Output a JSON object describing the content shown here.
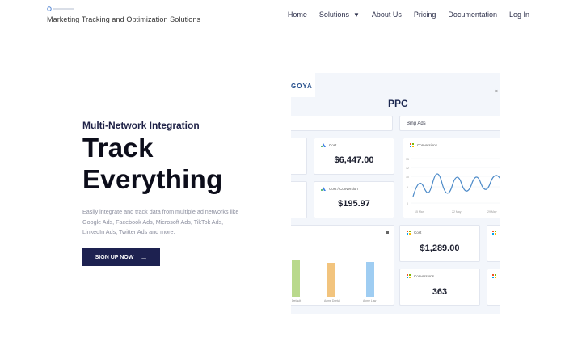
{
  "header": {
    "tagline": "Marketing Tracking and Optimization Solutions",
    "nav": [
      {
        "label": "Home"
      },
      {
        "label": "Solutions",
        "caret": "▼"
      },
      {
        "label": "About Us"
      },
      {
        "label": "Pricing"
      },
      {
        "label": "Documentation"
      },
      {
        "label": "Log In"
      }
    ]
  },
  "hero": {
    "eyebrow": "Multi-Network Integration",
    "title_line1": "Track",
    "title_line2": "Everything",
    "description": "Easily integrate and track data from multiple ad networks like Google Ads, Facebook Ads, Microsoft Ads, TikTok Ads, LinkedIn Ads, Twitter Ads and more.",
    "cta_label": "SIGN UP NOW",
    "cta_arrow": "→"
  },
  "dashboard": {
    "brand": "GOYA",
    "close": "×",
    "title": "PPC",
    "filter_selected": "Bing Ads",
    "cost_label": "Cost",
    "cost_value": "$6,447.00",
    "cpc_label": "Cost / Conversion",
    "cpc_value": "$195.97",
    "conv_chart_label": "Conversions",
    "conv_chart_yticks": [
      "15",
      "12",
      "10",
      "5",
      "0"
    ],
    "conv_chart_xticks": [
      "15 Mar",
      "22 May",
      "29 May"
    ],
    "bing_cost_label": "Cost",
    "bing_cost_value": "$1,289.00",
    "bing_conv_label": "Conversions",
    "bing_conv_value": "363",
    "bar_labels": [
      "Default",
      "Acme Dental",
      "Acme Law"
    ],
    "colors": {
      "bar1": "#b9d98c",
      "bar2": "#f2c47e",
      "bar3": "#9fcdf2",
      "line": "#4a89c8",
      "cta": "#1d2150"
    }
  }
}
